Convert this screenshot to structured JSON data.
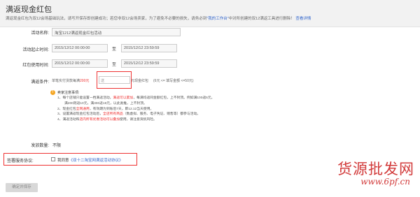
{
  "header": {
    "title": "满返现金红包",
    "desc_prefix": "满返现金红包为双12会场基础玩法，请写开保存即创建成功；若您非双12会场卖家，为了避免不必要的损失，请务必到",
    "desc_highlight": "\"我的工作台\"",
    "desc_suffix": "中对所创建的双12满返工具进行删除！",
    "desc_link": "查看详情"
  },
  "form": {
    "activity_name_label": "活动名称:",
    "activity_name_value": "淘宝1212满返现金红包活动",
    "period_label": "活动起止时间:",
    "period_start": "2015/12/12 00:00:00",
    "period_sep": "至",
    "period_end": "2015/12/12 23:59:59",
    "usage_label": "红包使用时间:",
    "usage_start": "2015/12/12 00:00:00",
    "usage_sep": "至",
    "usage_end": "2015/12/12 23:59:59",
    "condition_label": "满返条件:",
    "condition_prefix": "单笔实付货款每满",
    "condition_amount": "200元",
    "condition_input_placeholder": "送",
    "condition_mid": "元现金红包",
    "condition_suffix": "(6元 <= 填写金额 <=50元)"
  },
  "notes": {
    "title": "卖家注意事项:",
    "lines": [
      {
        "a": "1、每个店铺只能设置一档满返活动，",
        "red": "满返可以累加",
        "b": "，每满均返同金额红包，上不封顶。例如满100返5元，"
      },
      {
        "a": "满200则返10元，满300返15元，以此类推，上不封顶。",
        "red": "",
        "b": ""
      },
      {
        "a": "2、现金红包",
        "red": "全网通用",
        "b": "，有效期为到账后7天，即12.12当天使用。"
      },
      {
        "a": "3、设置满返现金红包活动后，",
        "red": "全店所有商品",
        "b": "（数虚拟、服务、电子凭证、赠售等）都参与活动。"
      },
      {
        "a": "4、满返活动和",
        "red": "店内所有优惠活动可以叠加",
        "b": "使用，请注意资损风险。"
      }
    ]
  },
  "send": {
    "label": "发放数量:",
    "value": "不限"
  },
  "agreement": {
    "label": "签署服务协议:",
    "text_prefix": "我同意",
    "link": "《双十二淘宝网满返活动协议》"
  },
  "submit": {
    "label": "确定并保存"
  },
  "watermark": {
    "text": "货源批发网",
    "url": "www.6pf.cn"
  }
}
